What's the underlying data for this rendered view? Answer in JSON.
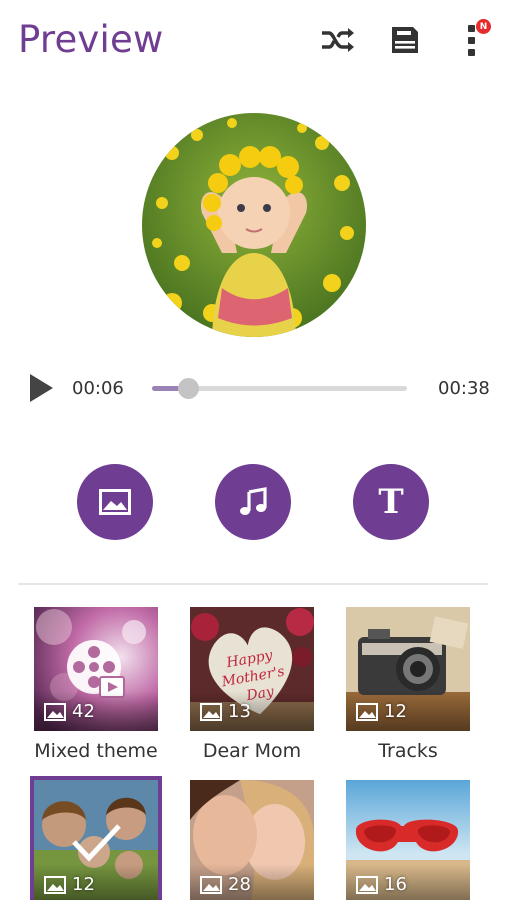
{
  "header": {
    "title": "Preview",
    "shuffle_icon": "shuffle-icon",
    "save_icon": "save-icon",
    "menu_icon": "more-vert-icon",
    "menu_badge": "N"
  },
  "colors": {
    "accent": "#6f3d92",
    "seek_fill": "#9b82b5",
    "badge": "#e52b2b"
  },
  "player": {
    "current_time": "00:06",
    "total_time": "00:38",
    "progress": 0.14
  },
  "actions": [
    {
      "name": "image",
      "icon": "image-icon"
    },
    {
      "name": "music",
      "icon": "music-note-icon"
    },
    {
      "name": "text",
      "icon": "text-icon",
      "glyph": "T"
    }
  ],
  "themes": [
    {
      "label": "Mixed theme",
      "count": "42",
      "selected": false
    },
    {
      "label": "Dear Mom",
      "count": "13",
      "selected": false,
      "card_text": "Happy Mother's Day"
    },
    {
      "label": "Tracks",
      "count": "12",
      "selected": false
    },
    {
      "label": "",
      "count": "12",
      "selected": true
    },
    {
      "label": "",
      "count": "28",
      "selected": false
    },
    {
      "label": "",
      "count": "16",
      "selected": false
    }
  ]
}
